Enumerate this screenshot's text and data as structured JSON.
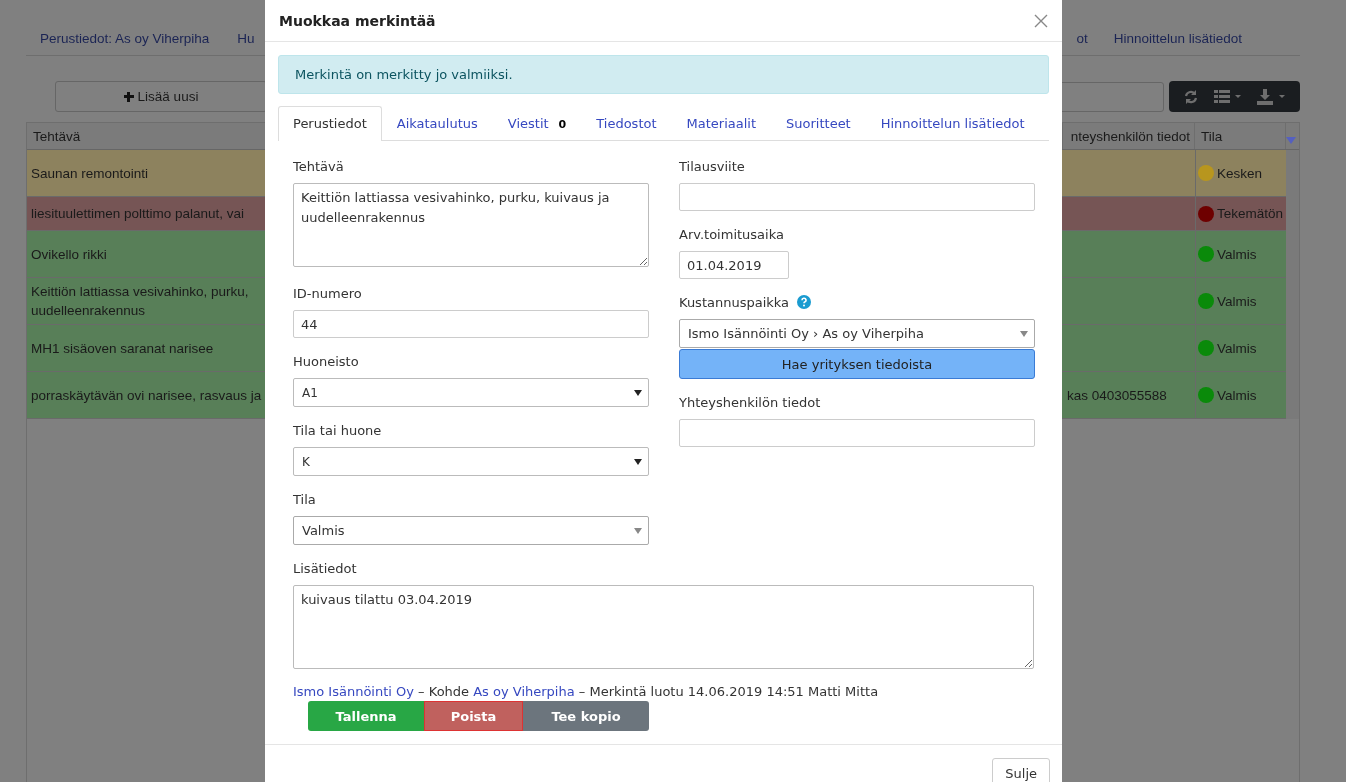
{
  "background": {
    "nav_tabs": [
      {
        "label": "Perustiedot: As oy Viherpiha"
      },
      {
        "label": "Hu"
      },
      {
        "label": "ot"
      },
      {
        "label": "Hinnoittelun lisätiedot"
      }
    ],
    "add_button": "Lisää uusi",
    "table": {
      "columns": [
        "Tehtävä",
        "nteyshenkilön tiedot",
        "Tila"
      ],
      "rows": [
        {
          "task": "Saunan remontointi",
          "status": "Kesken",
          "color": "#b8961e"
        },
        {
          "task": "liesituulettimen polttimo palanut, vai",
          "status": "Tekemätön",
          "color": "#6e0000"
        },
        {
          "task": "Ovikello rikki",
          "status": "Valmis",
          "color": "#0a8a0a"
        },
        {
          "task": "Keittiön lattiassa vesivahinko, purku,\nuudelleenrakennus",
          "status": "Valmis",
          "color": "#0a8a0a"
        },
        {
          "task": "MH1 sisäoven saranat narisee",
          "status": "Valmis",
          "color": "#0a8a0a"
        },
        {
          "task": "porraskäytävän ovi narisee, rasvaus ja",
          "contact": "kas 0403055588",
          "status": "Valmis",
          "color": "#0a8a0a"
        }
      ]
    }
  },
  "modal": {
    "title": "Muokkaa merkintää",
    "alert": "Merkintä on merkitty jo valmiiksi.",
    "tabs": [
      {
        "label": "Perustiedot",
        "selected": true
      },
      {
        "label": "Aikataulutus",
        "selected": false
      },
      {
        "label": "Viestit",
        "badge": "0",
        "selected": false
      },
      {
        "label": "Tiedostot",
        "selected": false
      },
      {
        "label": "Materiaalit",
        "selected": false
      },
      {
        "label": "Suoritteet",
        "selected": false
      },
      {
        "label": "Hinnoittelun lisätiedot",
        "selected": false
      }
    ],
    "left_fields": [
      {
        "label": "Tehtävä",
        "kind": "textarea",
        "value": "Keittiön lattiassa vesivahinko, purku, kuivaus ja uudelleenrakennus"
      },
      {
        "label": "ID-numero",
        "kind": "text",
        "value": "44"
      },
      {
        "label": "Huoneisto",
        "kind": "select",
        "value": "A1"
      },
      {
        "label": "Tila tai huone",
        "kind": "select",
        "value": "K"
      },
      {
        "label": "Tila",
        "kind": "combo",
        "value": "Valmis"
      }
    ],
    "right_fields": [
      {
        "label": "Tilausviite",
        "kind": "text"
      },
      {
        "label": "Arv.toimitusaika",
        "kind": "date",
        "value": "01.04.2019"
      },
      {
        "label": "Kustannuspaikka",
        "kind": "combo",
        "value": "Ismo Isännöinti Oy › As oy Viherpiha",
        "help": true,
        "action": "Hae yrityksen tiedoista"
      },
      {
        "label": "Yhteyshenkilön tiedot",
        "kind": "text"
      }
    ],
    "notes": {
      "label": "Lisätiedot",
      "value": "kuivaus tilattu 03.04.2019"
    },
    "meta": [
      {
        "text": "Ismo Isännöinti Oy",
        "kind": "link"
      },
      {
        "text": " – Kohde ",
        "kind": "text"
      },
      {
        "text": "As oy Viherpiha",
        "kind": "link"
      },
      {
        "text": " – Merkintä luotu 14.06.2019 14:51 Matti Mitta",
        "kind": "text"
      }
    ],
    "actions": [
      {
        "label": "Tallenna",
        "kind": "success"
      },
      {
        "label": "Poista",
        "kind": "danger"
      },
      {
        "label": "Tee kopio",
        "kind": "secondary"
      }
    ],
    "close_button": "Sulje"
  }
}
